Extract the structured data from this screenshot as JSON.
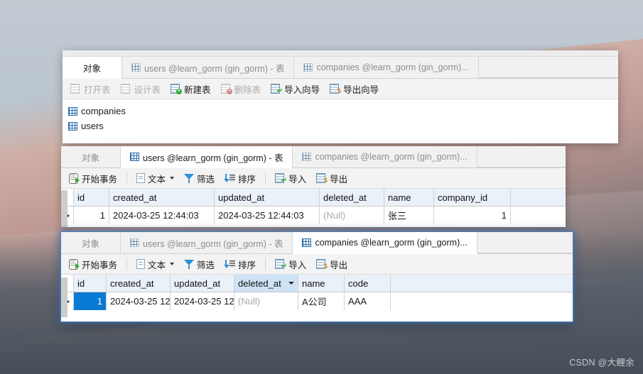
{
  "desktop": {
    "watermark": "CSDN @大鲤余"
  },
  "windows": [
    {
      "id": "object-browser-window",
      "tabs": [
        {
          "label": "对象",
          "icon": "",
          "selected": true
        },
        {
          "label": "users @learn_gorm (gin_gorm) - 表",
          "icon": "grid-icon",
          "selected": false
        },
        {
          "label": "companies @learn_gorm (gin_gorm)...",
          "icon": "grid-icon",
          "selected": false
        }
      ],
      "toolbar": [
        {
          "label": "打开表",
          "icon": "open-table-icon",
          "disabled": true
        },
        {
          "label": "设计表",
          "icon": "design-table-icon",
          "disabled": true
        },
        {
          "label": "新建表",
          "icon": "new-table-icon",
          "disabled": false
        },
        {
          "label": "删除表",
          "icon": "delete-table-icon",
          "disabled": true
        },
        {
          "label": "导入向导",
          "icon": "import-wizard-icon",
          "disabled": false
        },
        {
          "label": "导出向导",
          "icon": "export-wizard-icon",
          "disabled": false
        }
      ],
      "objects": [
        {
          "label": "companies",
          "icon": "table-icon"
        },
        {
          "label": "users",
          "icon": "table-icon"
        }
      ]
    },
    {
      "id": "users-table-window",
      "tabs": [
        {
          "label": "对象",
          "icon": "",
          "selected": false
        },
        {
          "label": "users @learn_gorm (gin_gorm) - 表",
          "icon": "grid-icon",
          "selected": true
        },
        {
          "label": "companies @learn_gorm (gin_gorm)...",
          "icon": "grid-icon",
          "selected": false
        }
      ],
      "toolbar": [
        {
          "label": "开始事务",
          "icon": "begin-transaction-icon"
        },
        {
          "label": "文本",
          "icon": "text-icon",
          "caret": true
        },
        {
          "label": "筛选",
          "icon": "filter-icon"
        },
        {
          "label": "排序",
          "icon": "sort-icon"
        },
        {
          "label": "导入",
          "icon": "import-icon"
        },
        {
          "label": "导出",
          "icon": "export-icon"
        }
      ],
      "grid": {
        "columns": [
          "id",
          "created_at",
          "updated_at",
          "deleted_at",
          "name",
          "company_id"
        ],
        "rows": [
          [
            "1",
            "2024-03-25 12:44:03",
            "2024-03-25 12:44:03",
            "(Null)",
            "张三",
            "1"
          ]
        ]
      }
    },
    {
      "id": "companies-table-window",
      "tabs": [
        {
          "label": "对象",
          "icon": "",
          "selected": false
        },
        {
          "label": "users @learn_gorm (gin_gorm) - 表",
          "icon": "grid-icon",
          "selected": false
        },
        {
          "label": "companies @learn_gorm (gin_gorm)...",
          "icon": "grid-icon",
          "selected": true
        }
      ],
      "toolbar": [
        {
          "label": "开始事务",
          "icon": "begin-transaction-icon"
        },
        {
          "label": "文本",
          "icon": "text-icon",
          "caret": true
        },
        {
          "label": "筛选",
          "icon": "filter-icon"
        },
        {
          "label": "排序",
          "icon": "sort-icon"
        },
        {
          "label": "导入",
          "icon": "import-icon"
        },
        {
          "label": "导出",
          "icon": "export-icon"
        }
      ],
      "grid": {
        "columns": [
          "id",
          "created_at",
          "updated_at",
          "deleted_at",
          "name",
          "code"
        ],
        "selected_column": "deleted_at",
        "rows": [
          [
            "1",
            "2024-03-25 12",
            "2024-03-25 12:",
            "(Null)",
            "A公司",
            "AAA"
          ]
        ]
      }
    }
  ],
  "colors": {
    "accent": "#0a7bd4",
    "header_bg": "#eaf1f8",
    "header_sel_bg": "#cfe3f7",
    "active_window_glow": "#4a7ebb",
    "null_text": "#a9a9a9"
  }
}
